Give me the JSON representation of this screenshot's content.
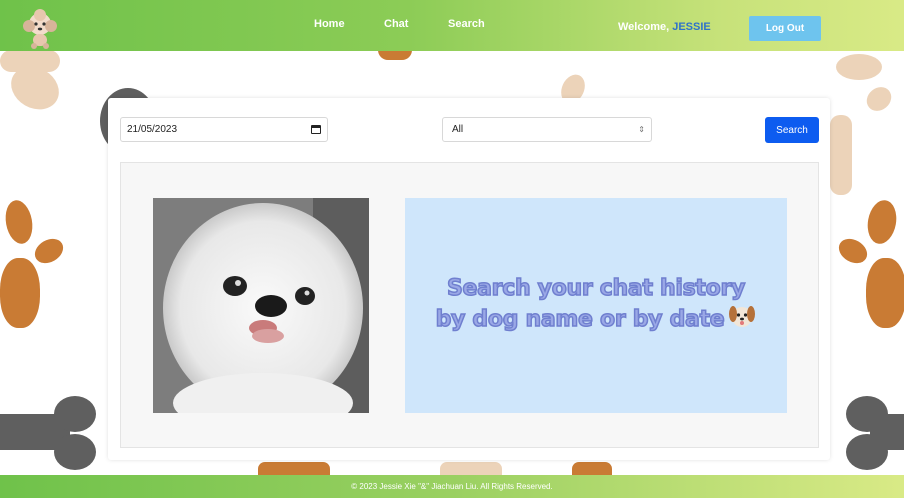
{
  "header": {
    "logo_icon": "poodle-logo-icon",
    "nav": [
      {
        "label": "Home"
      },
      {
        "label": "Chat"
      },
      {
        "label": "Search"
      }
    ],
    "welcome_prefix": "Welcome,",
    "username": "JESSIE",
    "logout_label": "Log Out"
  },
  "search": {
    "date_value": "21/05/2023",
    "calendar_icon": "calendar-icon",
    "dog_filter_value": "All",
    "submit_label": "Search"
  },
  "results": {
    "photo_icon": "white-pomeranian-photo",
    "banner_line1": "Search your chat history",
    "banner_line2": "by dog name or by date",
    "banner_emoji": "dog-face-icon"
  },
  "footer": {
    "copyright": "© 2023 Jessie Xie \"&\" Jiachuan Liu. All Rights Reserved."
  },
  "colors": {
    "header_gradient_start": "#6fc24a",
    "header_gradient_end": "#d9ea86",
    "username": "#2f73c9",
    "logout_bg": "#6ec4ee",
    "search_btn": "#0d5cf0",
    "banner_bg": "#cfe6fb"
  }
}
